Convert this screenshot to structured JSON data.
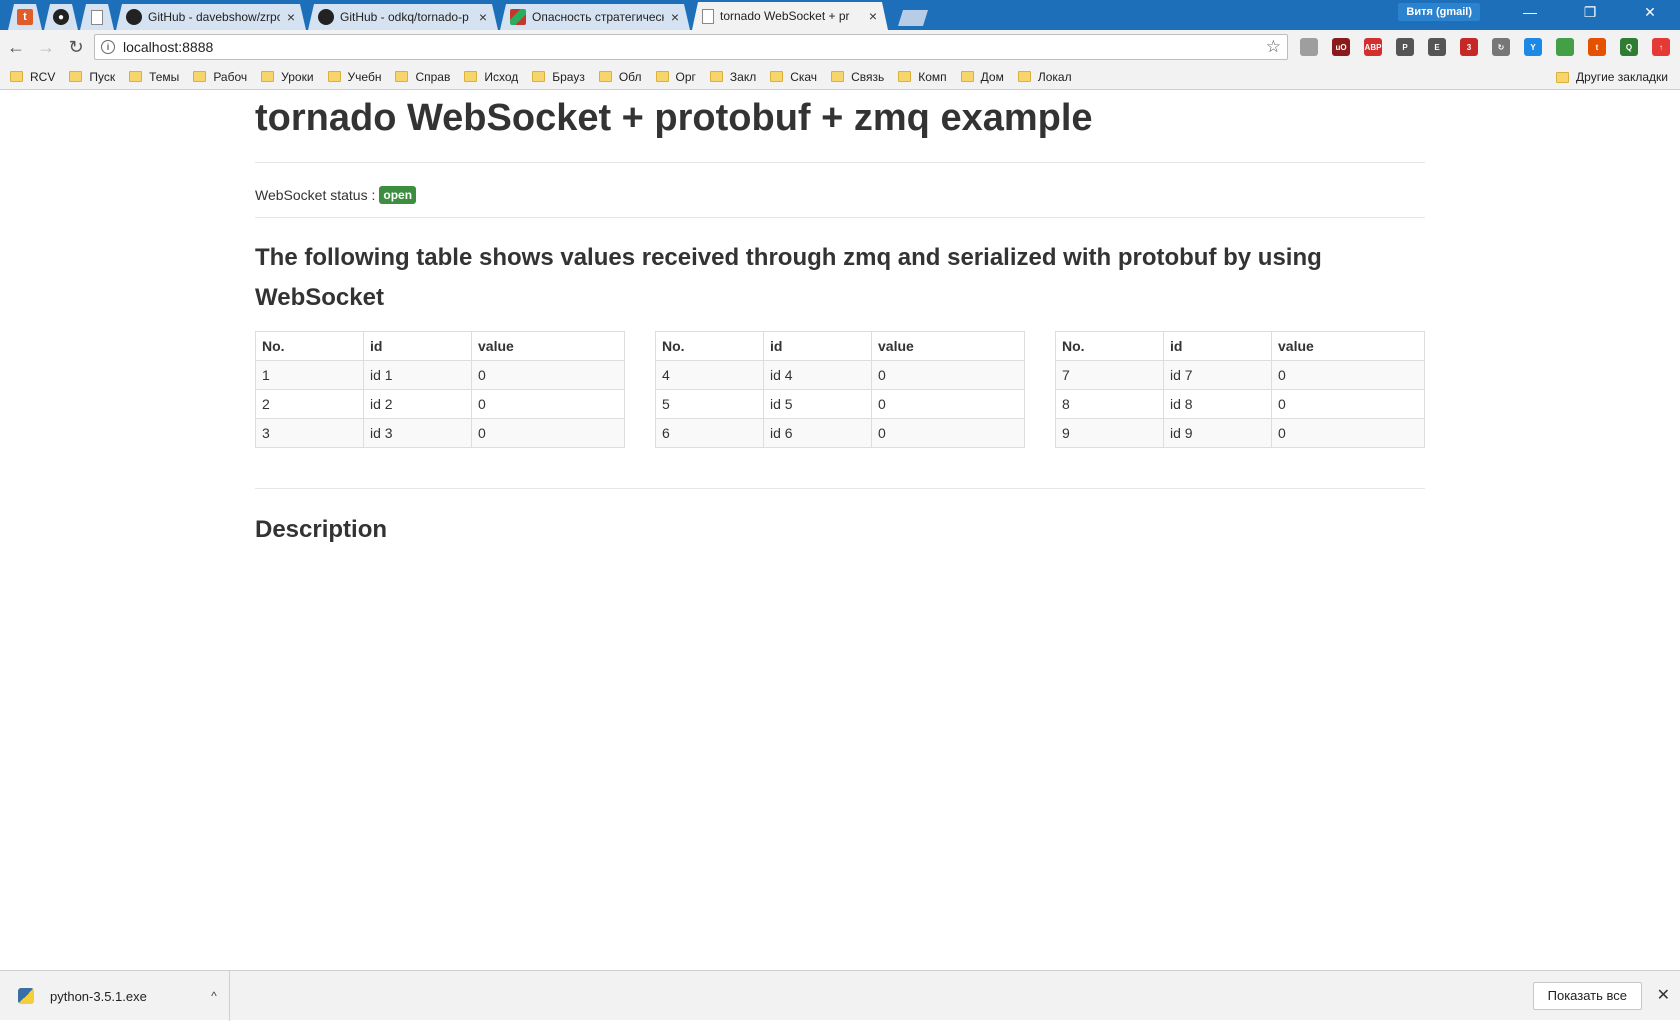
{
  "browser": {
    "tabs": [
      {
        "type": "pinned",
        "icon": "tumblr-icon",
        "glyph": "t"
      },
      {
        "type": "pinned",
        "icon": "github-icon",
        "glyph": "●"
      },
      {
        "type": "pinned",
        "icon": "document-icon",
        "glyph": ""
      },
      {
        "type": "normal",
        "icon": "github-icon",
        "title": "GitHub - davebshow/zrpc",
        "close": "×"
      },
      {
        "type": "normal",
        "icon": "github-icon",
        "title": "GitHub - odkq/tornado-p",
        "close": "×"
      },
      {
        "type": "normal",
        "icon": "stripe-icon",
        "title": "Опасность стратегическ",
        "close": "×"
      },
      {
        "type": "active",
        "icon": "document-icon",
        "title": "tornado WebSocket + pr",
        "close": "×"
      }
    ],
    "profile_name": "Витя (gmail)",
    "window_controls": {
      "minimize": "—",
      "restore": "❐",
      "close": "✕"
    },
    "nav": {
      "back": "←",
      "forward": "→",
      "reload": "↻"
    },
    "address": "localhost:8888",
    "star": "☆",
    "extensions": [
      {
        "name": "globe-ext-icon",
        "color": "#9e9e9e",
        "label": ""
      },
      {
        "name": "ublock-ext-icon",
        "color": "#8b1a1a",
        "label": "uO"
      },
      {
        "name": "adblock-plus-ext-icon",
        "color": "#d32f2f",
        "label": "ABP"
      },
      {
        "name": "pocket-ext-icon",
        "color": "#555555",
        "label": "P"
      },
      {
        "name": "evernote-ext-icon",
        "color": "#555555",
        "label": "E"
      },
      {
        "name": "badge-ext-icon",
        "color": "#c62828",
        "label": "3"
      },
      {
        "name": "sync-ext-icon",
        "color": "#777777",
        "label": "↻"
      },
      {
        "name": "translate-ext-icon",
        "color": "#1e88e5",
        "label": "Y"
      },
      {
        "name": "battery-ext-icon",
        "color": "#43a047",
        "label": ""
      },
      {
        "name": "tumblr-ext-icon",
        "color": "#e65100",
        "label": "t"
      },
      {
        "name": "scanner-ext-icon",
        "color": "#2e7d32",
        "label": "Q"
      },
      {
        "name": "arrow-up-ext-icon",
        "color": "#e53935",
        "label": "↑"
      }
    ],
    "bookmarks": [
      "RCV",
      "Пуск",
      "Темы",
      "Рабоч",
      "Уроки",
      "Учебн",
      "Справ",
      "Исход",
      "Брауз",
      "Обл",
      "Орг",
      "Закл",
      "Скач",
      "Связь",
      "Комп",
      "Дом",
      "Локал"
    ],
    "other_bookmarks": "Другие закладки"
  },
  "page": {
    "title": "tornado WebSocket + protobuf + zmq example",
    "status_label": "WebSocket status :",
    "status_value": "open",
    "section_heading": "The following table shows values received through zmq and serialized with protobuf by using WebSocket",
    "table_headers": [
      "No.",
      "id",
      "value"
    ],
    "tables": [
      [
        [
          "1",
          "id 1",
          "0"
        ],
        [
          "2",
          "id 2",
          "0"
        ],
        [
          "3",
          "id 3",
          "0"
        ]
      ],
      [
        [
          "4",
          "id 4",
          "0"
        ],
        [
          "5",
          "id 5",
          "0"
        ],
        [
          "6",
          "id 6",
          "0"
        ]
      ],
      [
        [
          "7",
          "id 7",
          "0"
        ],
        [
          "8",
          "id 8",
          "0"
        ],
        [
          "9",
          "id 9",
          "0"
        ]
      ]
    ],
    "description_heading": "Description"
  },
  "downloads": {
    "file_name": "python-3.5.1.exe",
    "chevron": "^",
    "show_all": "Показать все",
    "close": "✕"
  }
}
